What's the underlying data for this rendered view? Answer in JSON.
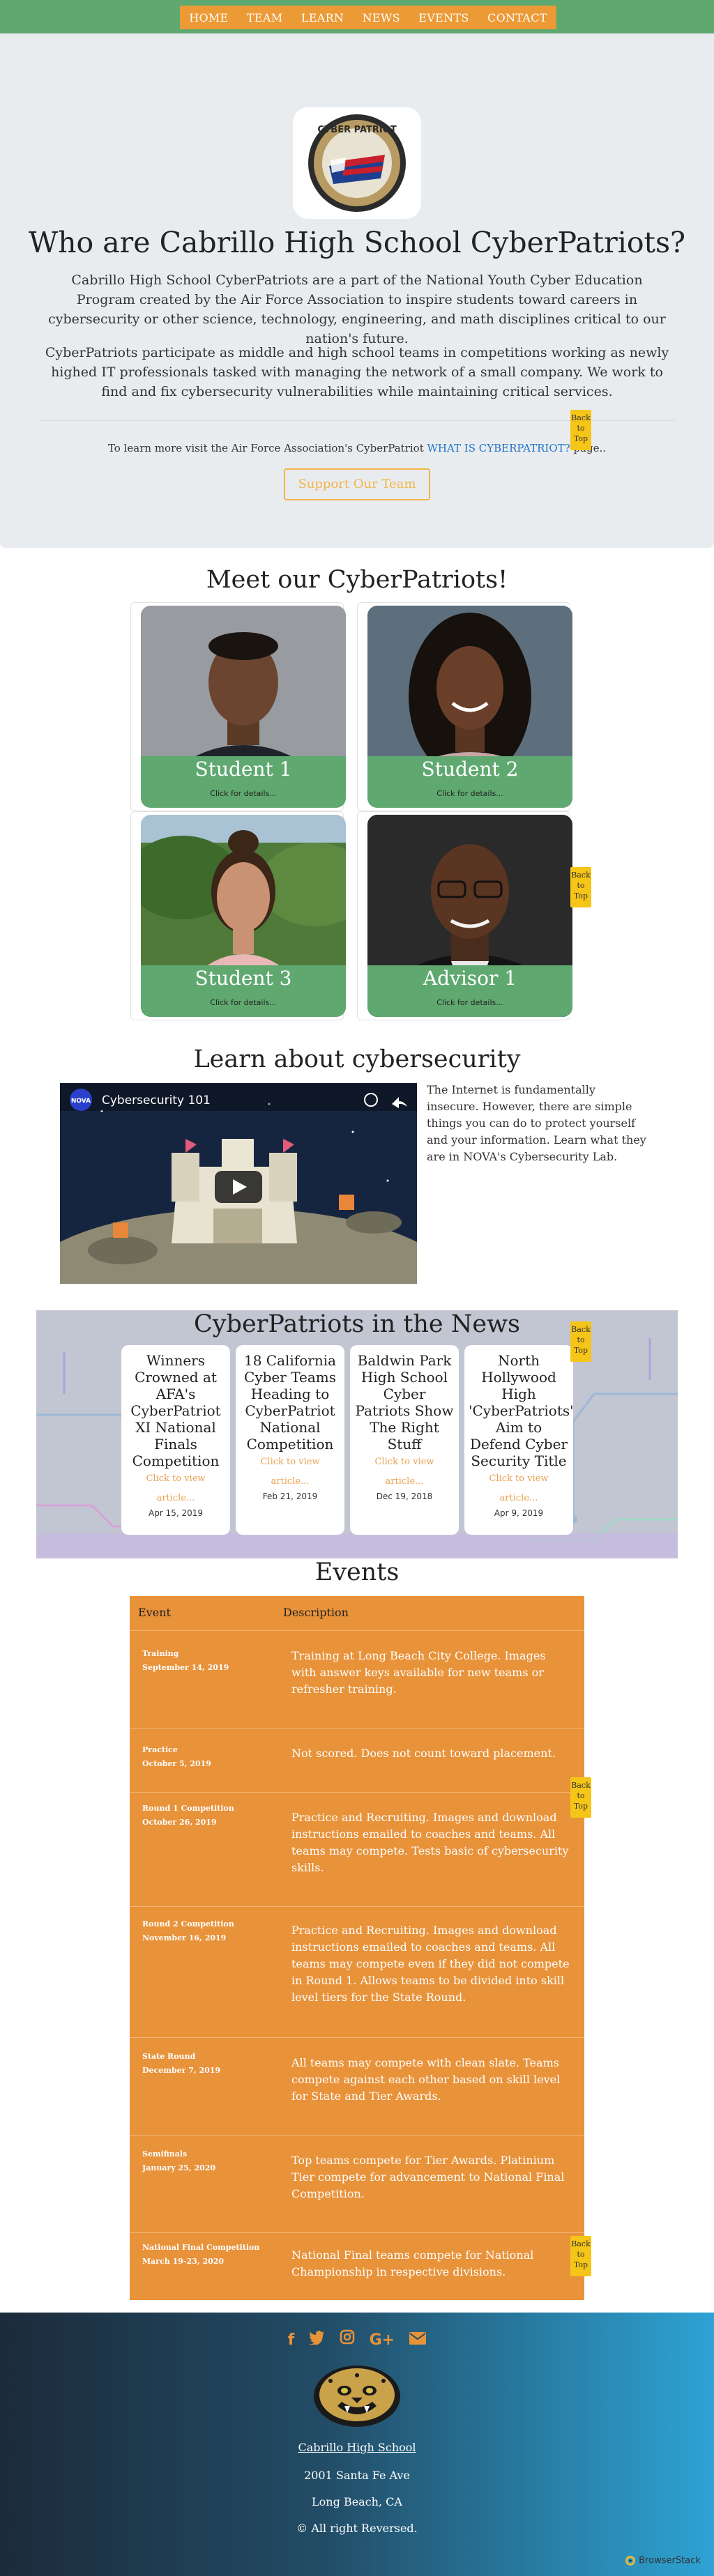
{
  "nav": {
    "items": [
      "HOME",
      "TEAM",
      "LEARN",
      "NEWS",
      "EVENTS",
      "CONTACT"
    ]
  },
  "hero": {
    "logo_text": "CYBER PATRIOT",
    "title": "Who are Cabrillo High School CyberPatriots?",
    "para1": "Cabrillo High School CyberPatriots are a part of the National Youth Cyber Education Program created by the Air Force Association to inspire students toward careers in cybersecurity or other science, technology, engineering, and math disciplines critical to our nation's future.",
    "para2": "CyberPatriots participate as middle and high school teams in competitions working as newly highed IT professionals tasked with managing the network of a small company. We work to find and fix cybersecurity vulnerabilities while maintaining critical services.",
    "visit_prefix": "To learn more visit the Air Force Association's CyberPatriot ",
    "visit_link": "WHAT IS CYBERPATRIOT?",
    "visit_suffix": " page..",
    "support_button": "Support Our Team"
  },
  "back_to_top": {
    "line1": "Back",
    "line2": "to",
    "line3": "Top"
  },
  "team": {
    "title": "Meet our CyberPatriots!",
    "click_text": "Click for details...",
    "members": [
      {
        "name": "Student 1"
      },
      {
        "name": "Student 2"
      },
      {
        "name": "Student 3"
      },
      {
        "name": "Advisor 1"
      }
    ]
  },
  "learn": {
    "title": "Learn about cybersecurity",
    "video_channel": "NOVA",
    "video_title": "Cybersecurity 101",
    "text": "The Internet is fundamentally insecure. However, there are simple things you can do to protect yourself and your information. Learn what they are in NOVA's Cybersecurity Lab."
  },
  "news": {
    "title": "CyberPatriots in the News",
    "link_text": "Click to view article...",
    "articles": [
      {
        "title": "Winners Crowned at AFA's CyberPatriot XI National Finals Competition",
        "date": "Apr 15, 2019"
      },
      {
        "title": "18 California Cyber Teams Heading to CyberPatriot National Competition",
        "date": "Feb 21, 2019"
      },
      {
        "title": "Baldwin Park High School Cyber Patriots Show The Right Stuff",
        "date": "Dec 19, 2018"
      },
      {
        "title": "North Hollywood High 'CyberPatriots' Aim to Defend Cyber Security Title",
        "date": "Apr 9, 2019"
      }
    ]
  },
  "events": {
    "title": "Events",
    "col_event": "Event",
    "col_desc": "Description",
    "rows": [
      {
        "name": "Training",
        "date": "September 14, 2019",
        "desc": "Training at Long Beach City College. Images with answer keys available for new teams or refresher training."
      },
      {
        "name": "Practice",
        "date": "October 5, 2019",
        "desc": "Not scored. Does not count toward placement."
      },
      {
        "name": "Round 1 Competition",
        "date": "October 26, 2019",
        "desc": "Practice and Recruiting. Images and download instructions emailed to coaches and teams. All teams may compete. Tests basic of cybersecurity skills."
      },
      {
        "name": "Round 2 Competition",
        "date": "November 16, 2019",
        "desc": "Practice and Recruiting. Images and download instructions emailed to coaches and teams. All teams may compete even if they did not compete in Round 1. Allows teams to be divided into skill level tiers for the State Round."
      },
      {
        "name": "State Round",
        "date": "December 7, 2019",
        "desc": "All teams may compete with clean slate. Teams compete against each other based on skill level for State and Tier Awards."
      },
      {
        "name": "Semifinals",
        "date": "January 25, 2020",
        "desc": "Top teams compete for Tier Awards. Platinium Tier compete for advancement to National Final Competition."
      },
      {
        "name": "National Final Competition",
        "date": "March 19-23, 2020",
        "desc": "National Final teams compete for National Championship in respective divisions."
      }
    ]
  },
  "footer": {
    "school": "Cabrillo High School",
    "address": "2001 Santa Fe Ave",
    "city": "Long Beach, CA",
    "rights": "© All right Reversed.",
    "social_icons": [
      "facebook-icon",
      "twitter-icon",
      "instagram-icon",
      "google-plus-icon",
      "envelope-icon"
    ],
    "badge": "BrowserStack"
  },
  "colors": {
    "green": "#5fa870",
    "orange": "#e8923a",
    "nav_orange": "#ec9a35",
    "hero_bg": "#e9ecef",
    "link_blue": "#1e73c8",
    "back_to_top_yellow": "#f5c518"
  }
}
